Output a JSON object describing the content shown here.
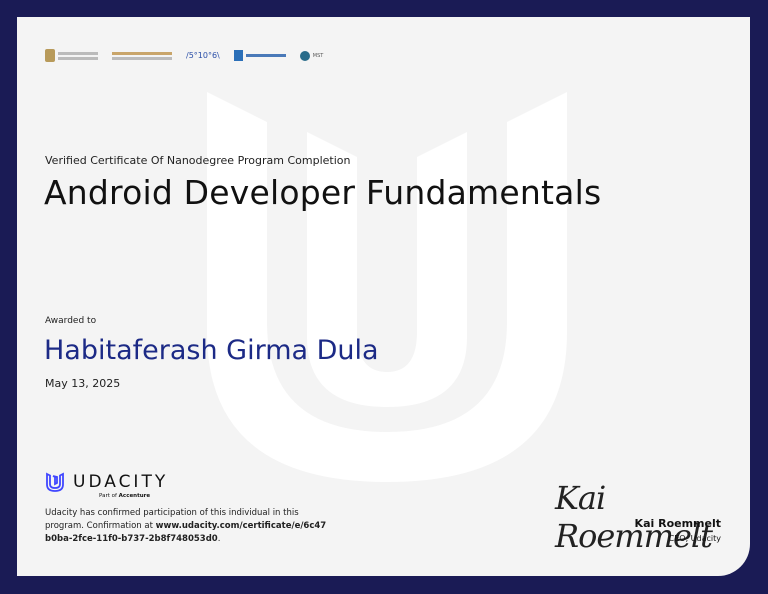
{
  "header": {
    "partner_logos": [
      "uae-emblem-logo",
      "arabic-text-logo",
      "5-10-6-logo",
      "dubai-future-logo",
      "mst-logo"
    ]
  },
  "certificate": {
    "subtitle": "Verified Certificate Of Nanodegree Program Completion",
    "title": "Android Developer Fundamentals",
    "awarded_label": "Awarded to",
    "recipient": "Habitaferash Girma Dula",
    "date": "May 13, 2025"
  },
  "brand": {
    "name": "UDACITY",
    "part_of": "Part of",
    "parent": "Accenture",
    "accent": "#4046ff"
  },
  "confirmation": {
    "text": "Udacity has confirmed participation of this individual in this program. Confirmation at ",
    "url": "www.udacity.com/certificate/e/6c47b0ba-2fce-11f0-b737-2b8f748053d0",
    "end": "."
  },
  "signature": {
    "script": "Kai Roemmelt",
    "name": "Kai Roemmelt",
    "role": "CEO, Udacity"
  }
}
